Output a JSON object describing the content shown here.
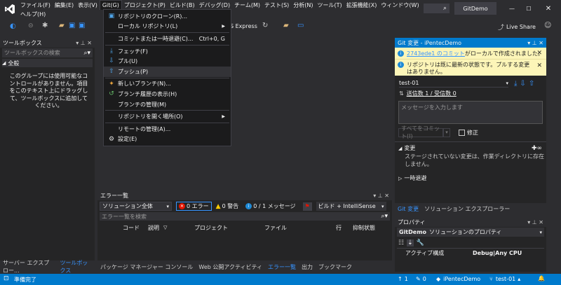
{
  "titlebar": {
    "menus": [
      "ファイル(F)",
      "編集(E)",
      "表示(V)",
      "Git(G)",
      "プロジェクト(P)",
      "ビルド(B)",
      "デバッグ(D)",
      "チーム(M)",
      "テスト(S)",
      "分析(N)",
      "ツール(T)",
      "拡張機能(X)",
      "ウィンドウ(W)"
    ],
    "help": "ヘルプ(H)",
    "search_icon": "search-icon",
    "solution_name": "GitDemo",
    "live_share": "Live Share"
  },
  "toolbar": {
    "run_label": "S Express"
  },
  "git_menu": {
    "items": [
      {
        "label": "リポジトリのクローン(R)...",
        "icon": "clone-icon"
      },
      {
        "label": "ローカル リポジトリ(L)",
        "icon": "",
        "arrow": true
      },
      {
        "sep": true
      },
      {
        "label": "コミットまたは一時退避(C)...",
        "shortcut": "Ctrl+0, G",
        "icon": ""
      },
      {
        "sep": true
      },
      {
        "label": "フェッチ(F)",
        "icon": "fetch-icon"
      },
      {
        "label": "プル(U)",
        "icon": "pull-icon"
      },
      {
        "label": "プッシュ(P)",
        "icon": "push-icon",
        "highlight": true
      },
      {
        "sep": true
      },
      {
        "label": "新しいブランチ(N)...",
        "icon": "branch-icon"
      },
      {
        "label": "ブランチ履歴の表示(H)",
        "icon": "history-icon"
      },
      {
        "label": "ブランチの管理(M)",
        "icon": ""
      },
      {
        "sep": true
      },
      {
        "label": "リポジトリを開く場所(O)",
        "icon": "",
        "arrow": true
      },
      {
        "sep": true
      },
      {
        "label": "リモートの管理(A)...",
        "icon": ""
      },
      {
        "label": "設定(E)",
        "icon": "gear-icon"
      }
    ]
  },
  "toolbox": {
    "title": "ツールボックス",
    "search_placeholder": "ツールボックスの検索",
    "group": "全般",
    "empty_message": "このグループには使用可能なコントロールがありません。項目をこのテキスト上にドラッグして、ツールボックスに追加してください。"
  },
  "left_tabs": [
    "サーバー エクスプロー...",
    "ツールボックス"
  ],
  "errors": {
    "title": "エラー一覧",
    "scope": "ソリューション全体",
    "errors_btn": "0 エラー",
    "warnings_btn": "0 警告",
    "messages_btn": "0 / 1 メッセージ",
    "build_filter": "ビルド + IntelliSense",
    "search_placeholder": "エラー一覧を検索",
    "columns": [
      "コード",
      "説明",
      "プロジェクト",
      "ファイル",
      "行",
      "抑制状態"
    ]
  },
  "bottom_tabs": [
    "パッケージ マネージャー コンソール",
    "Web 公開アクティビティ",
    "エラー一覧",
    "出力",
    "ブックマーク"
  ],
  "git_changes": {
    "title": "Git 変更 - iPentecDemo",
    "info1_link": "2743ede1 のコミット",
    "info1_rest": "がローカルで作成されました。",
    "info2": "リポジトリは既に最新の状態です。プルする変更はありません。",
    "branch": "test-01",
    "sync_status": "送信数 1 / 受信数 0",
    "message_placeholder": "メッセージを入力します",
    "commit_all": "すべてをコミット(I)",
    "amend": "修正",
    "changes_header": "変更",
    "no_changes": "ステージされていない変更は、作業ディレクトリに存在しません。",
    "stash_header": "一時退避"
  },
  "right_tabs": [
    "Git 変更",
    "ソリューション エクスプローラー"
  ],
  "properties": {
    "title": "プロパティ",
    "object": "GitDemo",
    "object_type": "ソリューションのプロパティ",
    "row_label": "アクティブ構成",
    "row_value": "Debug|Any CPU"
  },
  "status": {
    "ready": "準備完了",
    "up": "1",
    "pencil": "0",
    "repo": "iPentecDemo",
    "branch": "test-01"
  },
  "colors": {
    "accent": "#007acc",
    "menu_bg": "#1b1b1c",
    "panel_bg": "#252526",
    "info_bg": "#fcf5b8"
  }
}
